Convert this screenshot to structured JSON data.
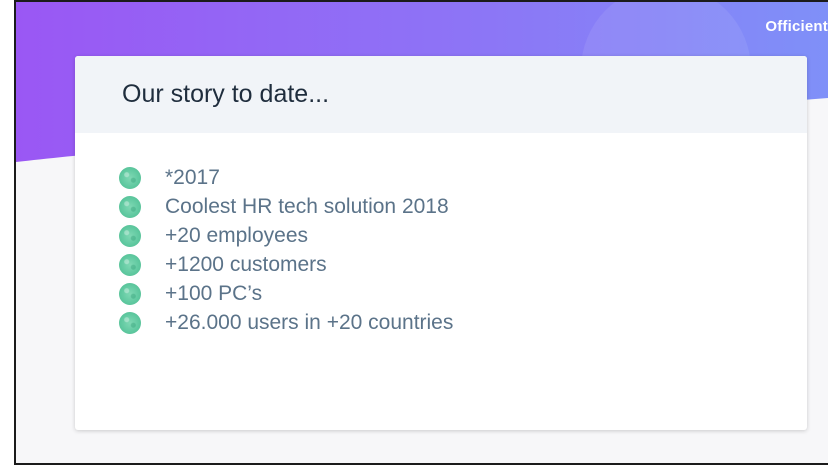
{
  "brand": {
    "name": "Officient"
  },
  "card": {
    "title": "Our story to date...",
    "facts": [
      {
        "text": "*2017"
      },
      {
        "text": "Coolest HR tech solution 2018"
      },
      {
        "text": "+20 employees"
      },
      {
        "text": "+1200 customers"
      },
      {
        "text": "+100 PC’s"
      },
      {
        "text": "+26.000 users in +20 countries"
      }
    ]
  },
  "colors": {
    "header_gradient_start": "#9b5df5",
    "header_gradient_end": "#7f8ff8",
    "bullet": "#6fd1aa",
    "fact_text": "#5b7389",
    "title_text": "#1f2d3d",
    "card_header_bg": "#f1f4f8"
  },
  "icons": {
    "bullet": "green-dot-icon"
  }
}
